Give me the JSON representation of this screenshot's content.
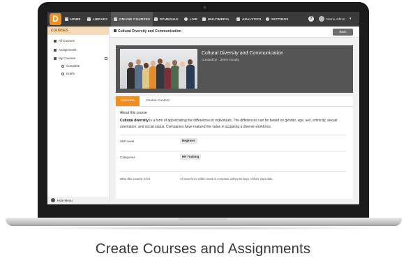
{
  "nav": {
    "logo": "D",
    "items": [
      {
        "label": "HOME",
        "icon": "home-icon"
      },
      {
        "label": "LIBRARY",
        "icon": "library-icon"
      },
      {
        "label": "ONLINE COURSES",
        "icon": "courses-icon"
      },
      {
        "label": "SCHEDULE",
        "icon": "calendar-icon"
      },
      {
        "label": "LIVE",
        "icon": "live-icon"
      },
      {
        "label": "MULTIMEDIA",
        "icon": "multimedia-icon"
      },
      {
        "label": "ANALYTICS",
        "icon": "analytics-icon"
      },
      {
        "label": "SETTINGS",
        "icon": "gear-icon"
      }
    ],
    "active_item": "ONLINE COURSES",
    "help": "?",
    "user": "Demo Admin",
    "user_caret": "▾"
  },
  "sidebar": {
    "header": "COURSES",
    "items": [
      "All Courses",
      "Assignments",
      "My Courses"
    ],
    "subitems": [
      "Complete",
      "Drafts"
    ],
    "hide_menu": "Hide Menu"
  },
  "main": {
    "header_title": "Cultural Diversity and Communication",
    "back": "Back",
    "course_title": "Cultural Diversity and Communication",
    "created_by": "Created by - Demo Faculty",
    "tabs": [
      "Overview",
      "Course Content"
    ],
    "about_heading": "About this course",
    "about_bold": "Cultural diversity",
    "about_text": " is a form of appreciating the differences in individuals. The differences can be based on gender, age, sex, ethnicity, sexual orientation, and social status. Companies have realized the value in acquiring a diverse workforce.",
    "details": [
      {
        "label": "Skill Level",
        "value": "Beginner"
      },
      {
        "label": "Categories",
        "value": "HR Training"
      },
      {
        "label": "Who this course is for",
        "value": "All new hires within need to complete within 90 days of their start date."
      }
    ]
  },
  "caption": "Create Courses and Assignments",
  "colors": {
    "accent": "#f18e1c",
    "nav_bg": "#3b3b3b",
    "banner_bg": "#545454"
  }
}
